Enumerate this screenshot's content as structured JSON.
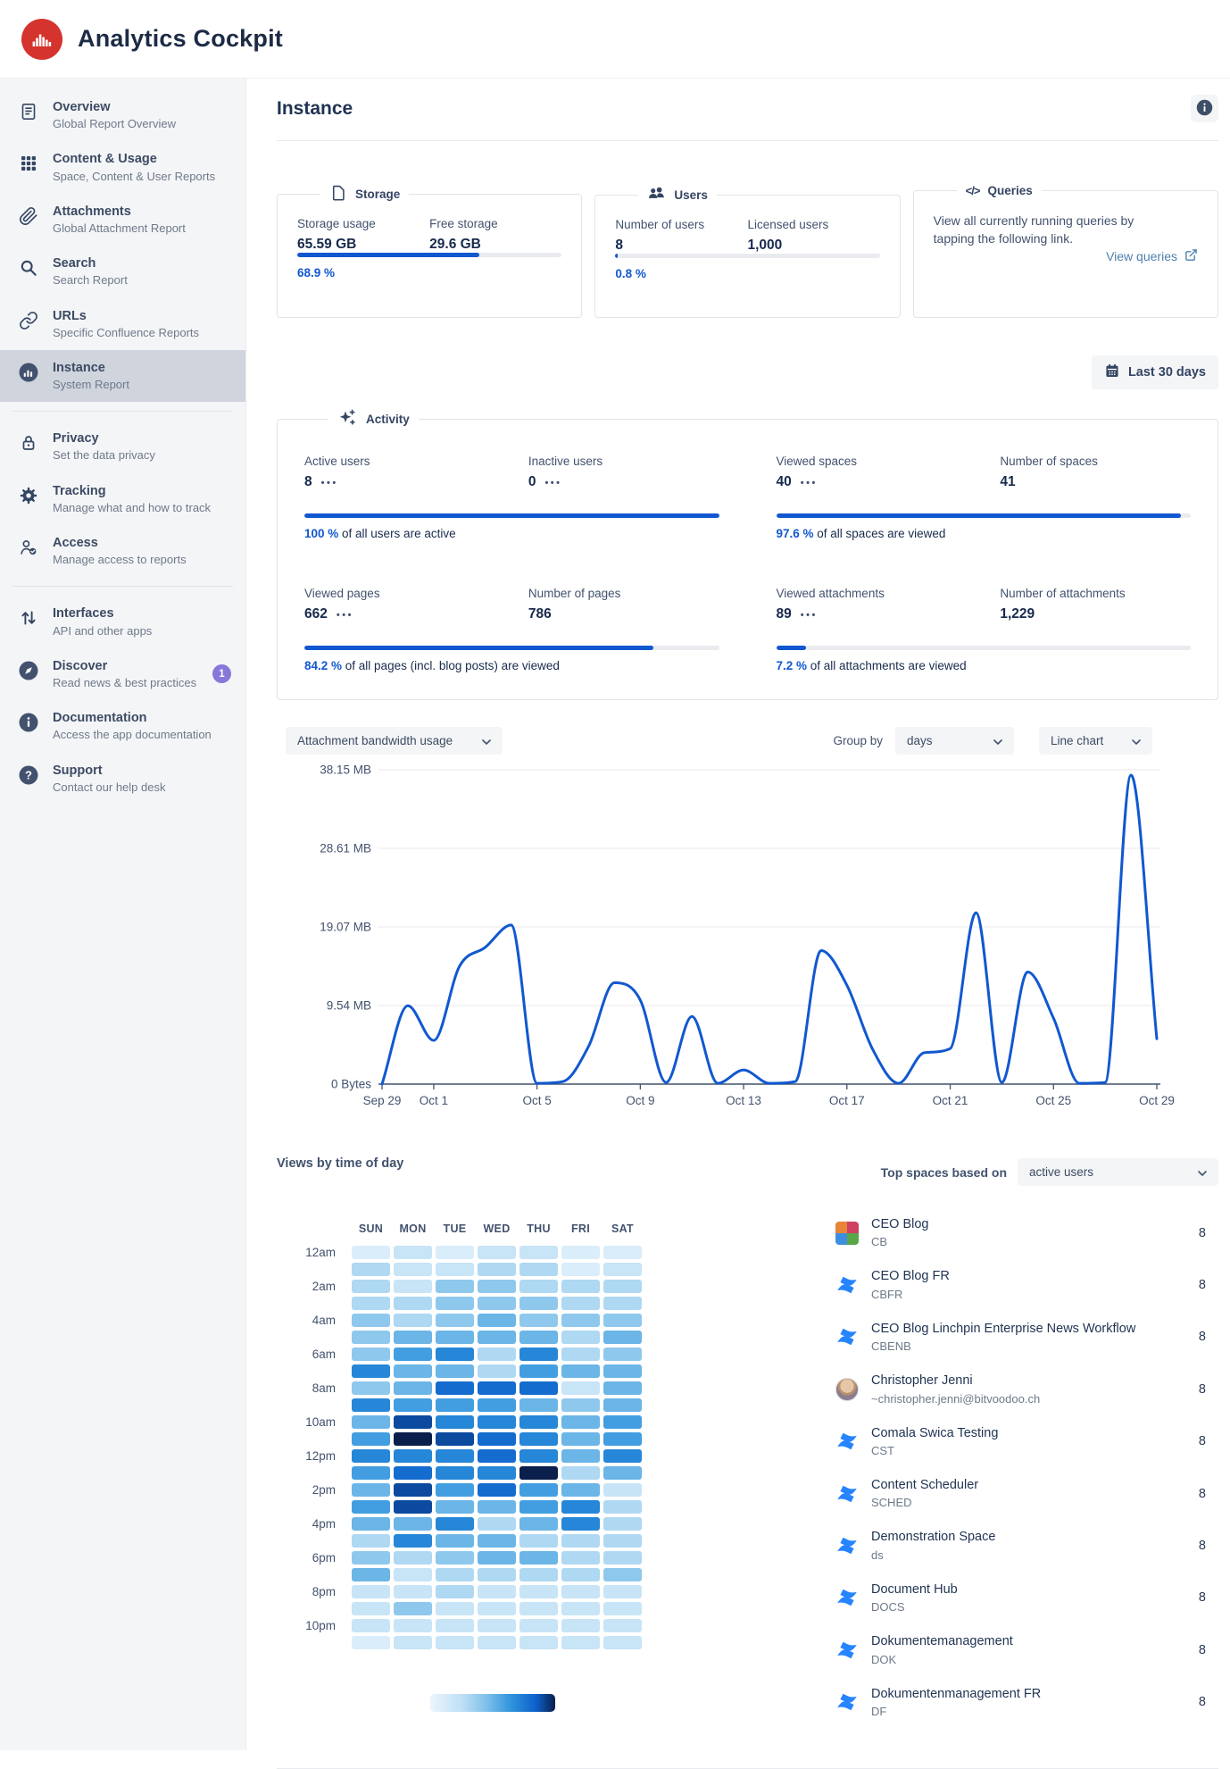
{
  "header": {
    "app_title": "Analytics Cockpit"
  },
  "colors": {
    "accent": "#1158d0",
    "logo_red": "#d5332d",
    "badge_purple": "#8777d9",
    "link_blue": "#4e7fae",
    "confluence_blue": "#2684ff"
  },
  "sidebar": {
    "sections": [
      {
        "items": [
          {
            "icon": "document-icon",
            "label": "Overview",
            "sublabel": "Global Report Overview"
          },
          {
            "icon": "grid-icon",
            "label": "Content & Usage",
            "sublabel": "Space, Content & User Reports"
          },
          {
            "icon": "paperclip-icon",
            "label": "Attachments",
            "sublabel": "Global Attachment Report"
          },
          {
            "icon": "search-icon",
            "label": "Search",
            "sublabel": "Search Report"
          },
          {
            "icon": "link-icon",
            "label": "URLs",
            "sublabel": "Specific Confluence Reports"
          },
          {
            "icon": "chart-circle-icon",
            "label": "Instance",
            "sublabel": "System Report",
            "selected": true
          }
        ]
      },
      {
        "items": [
          {
            "icon": "lock-icon",
            "label": "Privacy",
            "sublabel": "Set the data privacy"
          },
          {
            "icon": "gear-icon",
            "label": "Tracking",
            "sublabel": "Manage what and how to track"
          },
          {
            "icon": "user-check-icon",
            "label": "Access",
            "sublabel": "Manage access to reports"
          }
        ]
      },
      {
        "items": [
          {
            "icon": "arrows-up-down-icon",
            "label": "Interfaces",
            "sublabel": "API and other apps"
          },
          {
            "icon": "compass-icon",
            "label": "Discover",
            "sublabel": "Read news & best practices",
            "badge": "1"
          },
          {
            "icon": "info-circle-icon",
            "label": "Documentation",
            "sublabel": "Access the app documentation"
          },
          {
            "icon": "question-circle-icon",
            "label": "Support",
            "sublabel": "Contact our help desk"
          }
        ]
      }
    ]
  },
  "page": {
    "title": "Instance"
  },
  "cards": {
    "storage": {
      "legend": "Storage",
      "metrics": [
        {
          "label": "Storage usage",
          "value": "65.59 GB"
        },
        {
          "label": "Free storage",
          "value": "29.6 GB"
        }
      ],
      "progress_pct": 68.9,
      "progress_label": "68.9 %"
    },
    "users": {
      "legend": "Users",
      "metrics": [
        {
          "label": "Number of users",
          "value": "8"
        },
        {
          "label": "Licensed users",
          "value": "1,000"
        }
      ],
      "progress_pct": 0.8,
      "progress_label": "0.8 %"
    },
    "queries": {
      "legend": "Queries",
      "text": "View all currently running queries by tapping the following link.",
      "link_label": "View queries"
    }
  },
  "date_filter": {
    "label": "Last 30 days"
  },
  "activity": {
    "legend": "Activity",
    "blocks": [
      {
        "metrics": [
          {
            "label": "Active users",
            "value": "8",
            "more": true
          },
          {
            "label": "Inactive users",
            "value": "0",
            "more": true
          }
        ],
        "progress_pct": 100,
        "caption_value": "100 %",
        "caption_text": "of all users are active"
      },
      {
        "metrics": [
          {
            "label": "Viewed spaces",
            "value": "40",
            "more": true
          },
          {
            "label": "Number of spaces",
            "value": "41"
          }
        ],
        "progress_pct": 97.6,
        "caption_value": "97.6 %",
        "caption_text": "of all spaces are viewed"
      },
      {
        "metrics": [
          {
            "label": "Viewed pages",
            "value": "662",
            "more": true
          },
          {
            "label": "Number of pages",
            "value": "786"
          }
        ],
        "progress_pct": 84.2,
        "caption_value": "84.2 %",
        "caption_text": "of all pages (incl. blog posts) are viewed"
      },
      {
        "metrics": [
          {
            "label": "Viewed attachments",
            "value": "89",
            "more": true
          },
          {
            "label": "Number of attachments",
            "value": "1,229"
          }
        ],
        "progress_pct": 7.2,
        "caption_value": "7.2 %",
        "caption_text": "of all attachments are viewed"
      }
    ]
  },
  "chart_controls": {
    "metric_select": "Attachment bandwidth usage",
    "group_by_label": "Group by",
    "group_select": "days",
    "type_select": "Line chart"
  },
  "chart_data": [
    {
      "type": "line",
      "title": "Attachment bandwidth usage",
      "grid": true,
      "legend": "none",
      "line_color": "#1158d0",
      "x": [
        "Sep 29",
        "Sep 30",
        "Oct 1",
        "Oct 2",
        "Oct 3",
        "Oct 4",
        "Oct 5",
        "Oct 6",
        "Oct 7",
        "Oct 8",
        "Oct 9",
        "Oct 10",
        "Oct 11",
        "Oct 12",
        "Oct 13",
        "Oct 14",
        "Oct 15",
        "Oct 16",
        "Oct 17",
        "Oct 18",
        "Oct 19",
        "Oct 20",
        "Oct 21",
        "Oct 22",
        "Oct 23",
        "Oct 24",
        "Oct 25",
        "Oct 26",
        "Oct 27",
        "Oct 28",
        "Oct 29"
      ],
      "values_mb": [
        0,
        9.5,
        5.3,
        14.3,
        16.6,
        19.3,
        0.1,
        0.3,
        4.6,
        12.3,
        10.2,
        0.2,
        8.2,
        0.1,
        1.7,
        0.1,
        0.3,
        16.2,
        12.0,
        4.2,
        0.1,
        3.8,
        4.3,
        20.8,
        0.2,
        13.6,
        8.0,
        0.1,
        0.2,
        37.5,
        5.5
      ],
      "x_tick_labels": [
        "Sep 29",
        "Oct 1",
        "Oct 5",
        "Oct 9",
        "Oct 13",
        "Oct 17",
        "Oct 21",
        "Oct 25",
        "Oct 29"
      ],
      "x_tick_indices": [
        0,
        2,
        6,
        10,
        14,
        18,
        22,
        26,
        30
      ],
      "y_tick_labels": [
        "0 Bytes",
        "9.54 MB",
        "19.07 MB",
        "28.61 MB",
        "38.15 MB"
      ],
      "y_tick_values_mb": [
        0,
        9.54,
        19.07,
        28.61,
        38.15
      ],
      "ylim_mb": [
        0,
        40.5
      ]
    },
    {
      "type": "heatmap",
      "title": "Views by time of day",
      "columns": [
        "SUN",
        "MON",
        "TUE",
        "WED",
        "THU",
        "FRI",
        "SAT"
      ],
      "row_labels": [
        "12am",
        "2am",
        "4am",
        "6am",
        "8am",
        "10am",
        "12pm",
        "2pm",
        "4pm",
        "6pm",
        "8pm",
        "10pm"
      ],
      "rows_per_label": 2,
      "value_scale": [
        0,
        10
      ],
      "values": [
        [
          1,
          2,
          1,
          2,
          2,
          1,
          1
        ],
        [
          3,
          2,
          2,
          3,
          3,
          1,
          2
        ],
        [
          3,
          2,
          4,
          4,
          3,
          3,
          3
        ],
        [
          3,
          3,
          4,
          4,
          4,
          3,
          3
        ],
        [
          4,
          3,
          4,
          5,
          4,
          4,
          4
        ],
        [
          4,
          5,
          5,
          5,
          5,
          3,
          5
        ],
        [
          4,
          6,
          7,
          3,
          7,
          3,
          4
        ],
        [
          7,
          5,
          5,
          3,
          6,
          5,
          5
        ],
        [
          4,
          5,
          8,
          8,
          8,
          2,
          5
        ],
        [
          7,
          6,
          6,
          6,
          5,
          4,
          5
        ],
        [
          5,
          9,
          7,
          7,
          7,
          5,
          6
        ],
        [
          6,
          10,
          9,
          8,
          7,
          5,
          6
        ],
        [
          7,
          7,
          7,
          8,
          7,
          5,
          7
        ],
        [
          6,
          8,
          7,
          7,
          10,
          3,
          5
        ],
        [
          5,
          9,
          6,
          8,
          6,
          5,
          2
        ],
        [
          6,
          9,
          5,
          5,
          6,
          7,
          3
        ],
        [
          5,
          5,
          7,
          3,
          5,
          7,
          3
        ],
        [
          3,
          7,
          5,
          5,
          3,
          3,
          3
        ],
        [
          4,
          3,
          4,
          5,
          5,
          3,
          3
        ],
        [
          5,
          2,
          3,
          3,
          3,
          3,
          4
        ],
        [
          2,
          2,
          3,
          2,
          2,
          2,
          2
        ],
        [
          2,
          4,
          2,
          2,
          2,
          2,
          2
        ],
        [
          2,
          2,
          2,
          2,
          2,
          2,
          2
        ],
        [
          1,
          2,
          2,
          2,
          2,
          2,
          2
        ]
      ],
      "color_scale": [
        [
          0,
          "#ecf5fd"
        ],
        [
          0.25,
          "#bfe0f6"
        ],
        [
          0.45,
          "#7fc0ea"
        ],
        [
          0.65,
          "#2e93dc"
        ],
        [
          0.85,
          "#0c5fc9"
        ],
        [
          1,
          "#0a1f4c"
        ]
      ]
    }
  ],
  "heatmap_section": {
    "title": "Views by time of day"
  },
  "top_spaces": {
    "label": "Top spaces based on",
    "select": "active users",
    "items": [
      {
        "icon": "mosaic",
        "name": "CEO Blog",
        "key": "CB",
        "value": "8"
      },
      {
        "icon": "confluence",
        "name": "CEO Blog FR",
        "key": "CBFR",
        "value": "8"
      },
      {
        "icon": "confluence",
        "name": "CEO Blog Linchpin Enterprise News Workflow",
        "key": "CBENB",
        "value": "8"
      },
      {
        "icon": "avatar",
        "name": "Christopher Jenni",
        "key": "~christopher.jenni@bitvoodoo.ch",
        "value": "8"
      },
      {
        "icon": "confluence",
        "name": "Comala Swica Testing",
        "key": "CST",
        "value": "8"
      },
      {
        "icon": "confluence",
        "name": "Content Scheduler",
        "key": "SCHED",
        "value": "8"
      },
      {
        "icon": "confluence",
        "name": "Demonstration Space",
        "key": "ds",
        "value": "8"
      },
      {
        "icon": "confluence",
        "name": "Document Hub",
        "key": "DOCS",
        "value": "8"
      },
      {
        "icon": "confluence",
        "name": "Dokumentemanagement",
        "key": "DOK",
        "value": "8"
      },
      {
        "icon": "confluence",
        "name": "Dokumentenmanagement FR",
        "key": "DF",
        "value": "8"
      }
    ]
  }
}
